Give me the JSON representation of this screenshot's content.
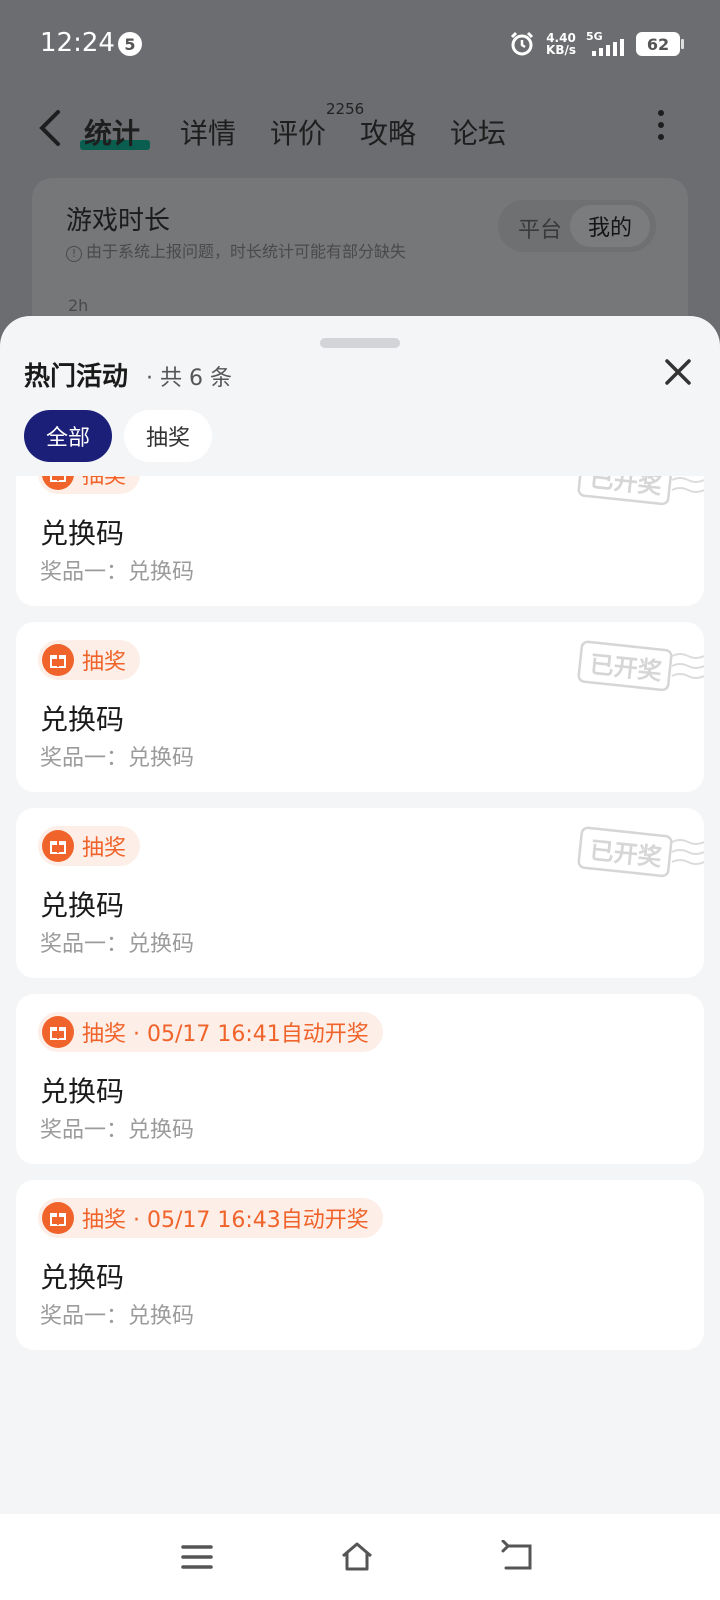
{
  "status": {
    "time": "12:24",
    "notif_count": "5",
    "speed_value": "4.40",
    "speed_unit": "KB/s",
    "network": "5G",
    "battery": "62"
  },
  "topnav": {
    "tabs": [
      "统计",
      "详情",
      "评价",
      "攻略",
      "论坛"
    ],
    "review_count": "2256"
  },
  "bg_card": {
    "title": "游戏时长",
    "note": "由于系统上报问题，时长统计可能有部分缺失",
    "seg_platform": "平台",
    "seg_mine": "我的",
    "axis_hint": "2h"
  },
  "sheet": {
    "title": "热门活动",
    "count": "· 共 6 条",
    "filters": [
      "全部",
      "抽奖"
    ]
  },
  "cards": [
    {
      "tag": "抽奖",
      "title": "兑换码",
      "prize": "奖品一：兑换码",
      "stamp": "已开奖"
    },
    {
      "tag": "抽奖",
      "title": "兑换码",
      "prize": "奖品一：兑换码",
      "stamp": "已开奖"
    },
    {
      "tag": "抽奖",
      "title": "兑换码",
      "prize": "奖品一：兑换码",
      "stamp": "已开奖"
    },
    {
      "tag": "抽奖 · 05/17 16:41自动开奖",
      "title": "兑换码",
      "prize": "奖品一：兑换码"
    },
    {
      "tag": "抽奖 · 05/17 16:43自动开奖",
      "title": "兑换码",
      "prize": "奖品一：兑换码"
    }
  ],
  "colors": {
    "accent": "#f0632a",
    "filter_active": "#1c1f78",
    "tab_underline": "#0a5e4f"
  }
}
